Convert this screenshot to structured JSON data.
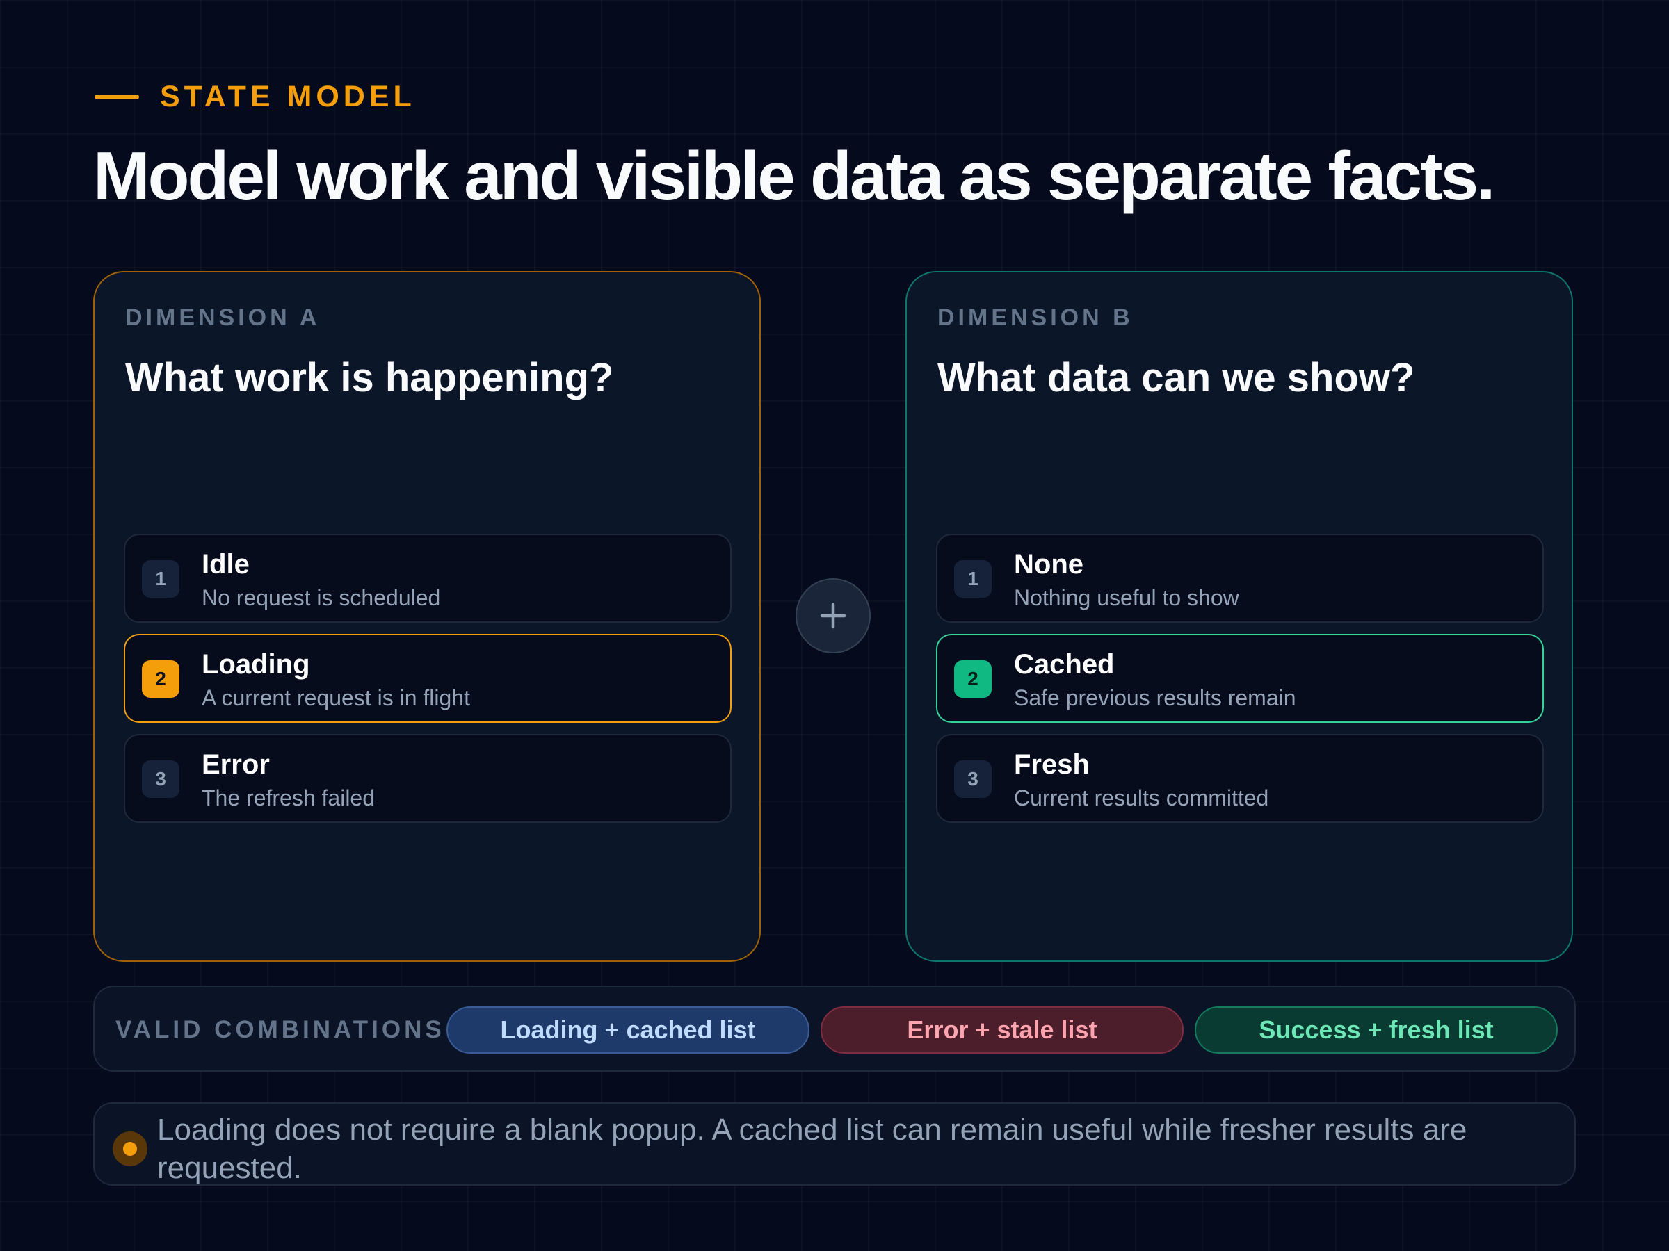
{
  "eyebrow": {
    "label": "STATE MODEL"
  },
  "headline": "Model work and visible data as separate facts.",
  "dimension_a": {
    "label": "DIMENSION A",
    "question": "What work is happening?",
    "states": [
      {
        "num": "1",
        "title": "Idle",
        "desc": "No request is scheduled",
        "active": false
      },
      {
        "num": "2",
        "title": "Loading",
        "desc": "A current request is in flight",
        "active": true
      },
      {
        "num": "3",
        "title": "Error",
        "desc": "The refresh failed",
        "active": false
      }
    ]
  },
  "combiner": {
    "icon": "plus-icon"
  },
  "dimension_b": {
    "label": "DIMENSION B",
    "question": "What data can we show?",
    "states": [
      {
        "num": "1",
        "title": "None",
        "desc": "Nothing useful to show",
        "active": false
      },
      {
        "num": "2",
        "title": "Cached",
        "desc": "Safe previous results remain",
        "active": true
      },
      {
        "num": "3",
        "title": "Fresh",
        "desc": "Current results committed",
        "active": false
      }
    ]
  },
  "combinations": {
    "label": "VALID COMBINATIONS",
    "items": [
      {
        "label": "Loading + cached list",
        "tone": "blue"
      },
      {
        "label": "Error + stale list",
        "tone": "red"
      },
      {
        "label": "Success + fresh list",
        "tone": "green"
      }
    ]
  },
  "note": {
    "icon": "status-dot-icon",
    "text": "Loading does not require a blank popup. A cached list can remain useful while fresher results are requested."
  },
  "colors": {
    "background": "#050b1c",
    "accent_amber": "#f59e0b",
    "accent_green": "#10b981",
    "panel_a_border": "#a16207",
    "panel_b_border": "#0f766e"
  }
}
